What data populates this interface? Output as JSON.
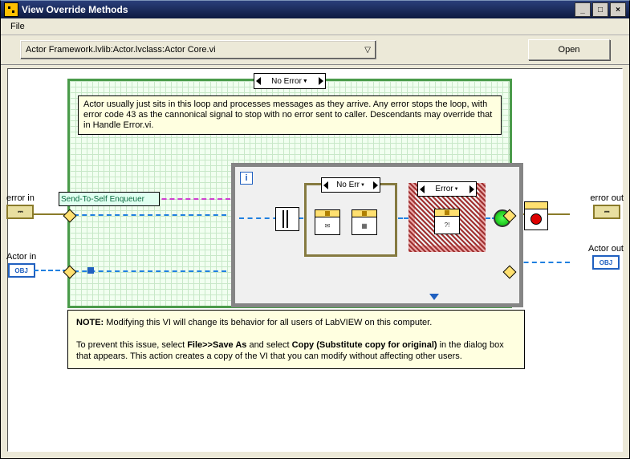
{
  "window": {
    "title": "View Override Methods"
  },
  "menu": {
    "file": "File"
  },
  "toolbar": {
    "combo_value": "Actor Framework.lvlib:Actor.lvclass:Actor Core.vi",
    "open_label": "Open"
  },
  "diagram": {
    "outer_case": "No Error",
    "comment1": "Actor usually just sits in this loop and processes messages as they arrive. Any error stops the loop, with error code 43 as the cannonical signal to stop with no error sent to caller. Descendants may override that in Handle Error.vi.",
    "send_enqueue": "Send-To-Self Enqueuer",
    "inner_noerr": "No Err",
    "inner_err": "Error",
    "terminals": {
      "error_in": "error in",
      "error_out": "error out",
      "actor_in": "Actor in",
      "actor_out": "Actor out",
      "obj": "OBJ"
    }
  },
  "note": {
    "prefix": "NOTE:",
    "line1": " Modifying this VI will change its behavior for all users of LabVIEW on this computer.",
    "line2a": "To prevent this issue, select ",
    "file_save": "File>>Save As",
    "line2b": " and select ",
    "copy_sub": "Copy (Substitute copy for original)",
    "line2c": " in the dialog box that appears. This action creates a copy of the VI that you can modify without affecting other users."
  }
}
